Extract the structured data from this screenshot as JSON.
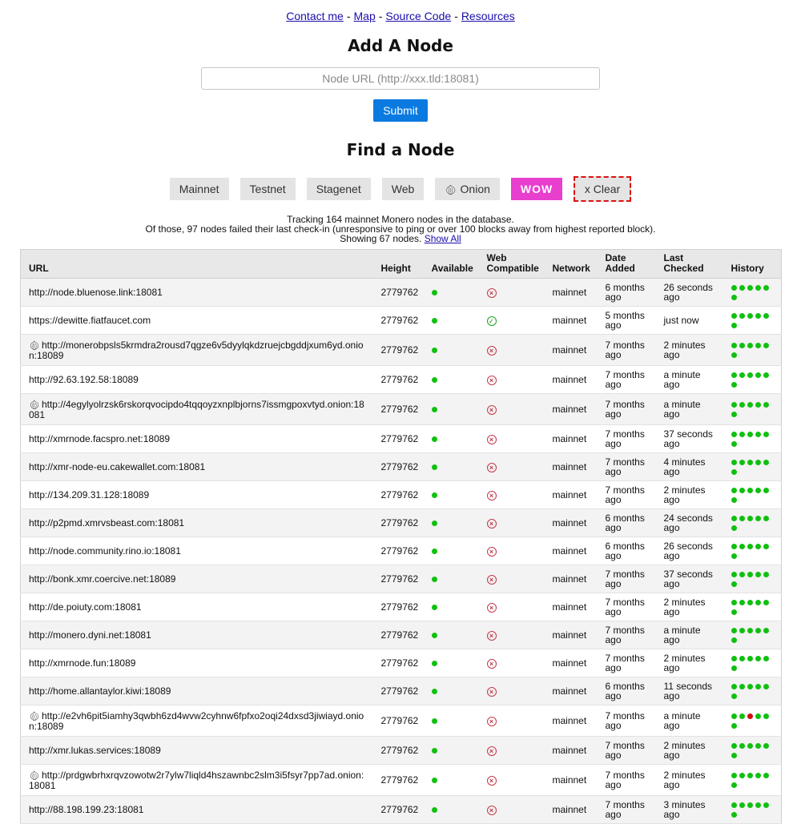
{
  "nav": {
    "contact": "Contact me",
    "map": "Map",
    "source": "Source Code",
    "resources": "Resources",
    "separator": "-"
  },
  "add_node": {
    "title": "Add A Node",
    "placeholder": "Node URL (http://xxx.tld:18081)",
    "submit": "Submit"
  },
  "find_node": {
    "title": "Find a Node",
    "filters": {
      "mainnet": "Mainnet",
      "testnet": "Testnet",
      "stagenet": "Stagenet",
      "web": "Web",
      "onion": "Onion",
      "wow": "WOW",
      "clear": "x Clear"
    }
  },
  "stats": {
    "line1": "Tracking 164 mainnet Monero nodes in the database.",
    "line2": "Of those, 97 nodes failed their last check-in (unresponsive to ping or over 100 blocks away from highest reported block).",
    "line3": "Showing 67 nodes.",
    "show_all": "Show All"
  },
  "table": {
    "headers": {
      "url": "URL",
      "height": "Height",
      "available": "Available",
      "web": "Web Compatible",
      "network": "Network",
      "date_added": "Date Added",
      "last_checked": "Last Checked",
      "history": "History"
    },
    "rows": [
      {
        "onion": false,
        "url": "http://node.bluenose.link:18081",
        "height": "2779762",
        "web": false,
        "network": "mainnet",
        "added": "6 months ago",
        "checked": "26 seconds ago",
        "history": [
          "green",
          "green",
          "green",
          "green",
          "green",
          "green"
        ]
      },
      {
        "onion": false,
        "url": "https://dewitte.fiatfaucet.com",
        "height": "2779762",
        "web": true,
        "network": "mainnet",
        "added": "5 months ago",
        "checked": "just now",
        "history": [
          "green",
          "green",
          "green",
          "green",
          "green",
          "green"
        ]
      },
      {
        "onion": true,
        "url": "http://monerobpsls5krmdra2rousd7qgze6v5dyylqkdzruejcbgddjxum6yd.onion:18089",
        "height": "2779762",
        "web": false,
        "network": "mainnet",
        "added": "7 months ago",
        "checked": "2 minutes ago",
        "history": [
          "green",
          "green",
          "green",
          "green",
          "green",
          "green"
        ]
      },
      {
        "onion": false,
        "url": "http://92.63.192.58:18089",
        "height": "2779762",
        "web": false,
        "network": "mainnet",
        "added": "7 months ago",
        "checked": "a minute ago",
        "history": [
          "green",
          "green",
          "green",
          "green",
          "green",
          "green"
        ]
      },
      {
        "onion": true,
        "url": "http://4egylyolrzsk6rskorqvocipdo4tqqoyzxnplbjorns7issmgpoxvtyd.onion:18081",
        "height": "2779762",
        "web": false,
        "network": "mainnet",
        "added": "7 months ago",
        "checked": "a minute ago",
        "history": [
          "green",
          "green",
          "green",
          "green",
          "green",
          "green"
        ]
      },
      {
        "onion": false,
        "url": "http://xmrnode.facspro.net:18089",
        "height": "2779762",
        "web": false,
        "network": "mainnet",
        "added": "7 months ago",
        "checked": "37 seconds ago",
        "history": [
          "green",
          "green",
          "green",
          "green",
          "green",
          "green"
        ]
      },
      {
        "onion": false,
        "url": "http://xmr-node-eu.cakewallet.com:18081",
        "height": "2779762",
        "web": false,
        "network": "mainnet",
        "added": "7 months ago",
        "checked": "4 minutes ago",
        "history": [
          "green",
          "green",
          "green",
          "green",
          "green",
          "green"
        ]
      },
      {
        "onion": false,
        "url": "http://134.209.31.128:18089",
        "height": "2779762",
        "web": false,
        "network": "mainnet",
        "added": "7 months ago",
        "checked": "2 minutes ago",
        "history": [
          "green",
          "green",
          "green",
          "green",
          "green",
          "green"
        ]
      },
      {
        "onion": false,
        "url": "http://p2pmd.xmrvsbeast.com:18081",
        "height": "2779762",
        "web": false,
        "network": "mainnet",
        "added": "6 months ago",
        "checked": "24 seconds ago",
        "history": [
          "green",
          "green",
          "green",
          "green",
          "green",
          "green"
        ]
      },
      {
        "onion": false,
        "url": "http://node.community.rino.io:18081",
        "height": "2779762",
        "web": false,
        "network": "mainnet",
        "added": "6 months ago",
        "checked": "26 seconds ago",
        "history": [
          "green",
          "green",
          "green",
          "green",
          "green",
          "green"
        ]
      },
      {
        "onion": false,
        "url": "http://bonk.xmr.coercive.net:18089",
        "height": "2779762",
        "web": false,
        "network": "mainnet",
        "added": "7 months ago",
        "checked": "37 seconds ago",
        "history": [
          "green",
          "green",
          "green",
          "green",
          "green",
          "green"
        ]
      },
      {
        "onion": false,
        "url": "http://de.poiuty.com:18081",
        "height": "2779762",
        "web": false,
        "network": "mainnet",
        "added": "7 months ago",
        "checked": "2 minutes ago",
        "history": [
          "green",
          "green",
          "green",
          "green",
          "green",
          "green"
        ]
      },
      {
        "onion": false,
        "url": "http://monero.dyni.net:18081",
        "height": "2779762",
        "web": false,
        "network": "mainnet",
        "added": "7 months ago",
        "checked": "a minute ago",
        "history": [
          "green",
          "green",
          "green",
          "green",
          "green",
          "green"
        ]
      },
      {
        "onion": false,
        "url": "http://xmrnode.fun:18089",
        "height": "2779762",
        "web": false,
        "network": "mainnet",
        "added": "7 months ago",
        "checked": "2 minutes ago",
        "history": [
          "green",
          "green",
          "green",
          "green",
          "green",
          "green"
        ]
      },
      {
        "onion": false,
        "url": "http://home.allantaylor.kiwi:18089",
        "height": "2779762",
        "web": false,
        "network": "mainnet",
        "added": "6 months ago",
        "checked": "11 seconds ago",
        "history": [
          "green",
          "green",
          "green",
          "green",
          "green",
          "green"
        ]
      },
      {
        "onion": true,
        "url": "http://e2vh6pit5iamhy3qwbh6zd4wvw2cyhnw6fpfxo2oqi24dxsd3jiwiayd.onion:18089",
        "height": "2779762",
        "web": false,
        "network": "mainnet",
        "added": "7 months ago",
        "checked": "a minute ago",
        "history": [
          "green",
          "green",
          "red",
          "green",
          "green",
          "green"
        ]
      },
      {
        "onion": false,
        "url": "http://xmr.lukas.services:18089",
        "height": "2779762",
        "web": false,
        "network": "mainnet",
        "added": "7 months ago",
        "checked": "2 minutes ago",
        "history": [
          "green",
          "green",
          "green",
          "green",
          "green",
          "green"
        ]
      },
      {
        "onion": true,
        "url": "http://prdgwbrhxrqvzowotw2r7ylw7liqld4hszawnbc2slm3i5fsyr7pp7ad.onion:18081",
        "height": "2779762",
        "web": false,
        "network": "mainnet",
        "added": "7 months ago",
        "checked": "2 minutes ago",
        "history": [
          "green",
          "green",
          "green",
          "green",
          "green",
          "green"
        ]
      },
      {
        "onion": false,
        "url": "http://88.198.199.23:18081",
        "height": "2779762",
        "web": false,
        "network": "mainnet",
        "added": "7 months ago",
        "checked": "3 minutes ago",
        "history": [
          "green",
          "green",
          "green",
          "green",
          "green",
          "green"
        ]
      }
    ]
  }
}
